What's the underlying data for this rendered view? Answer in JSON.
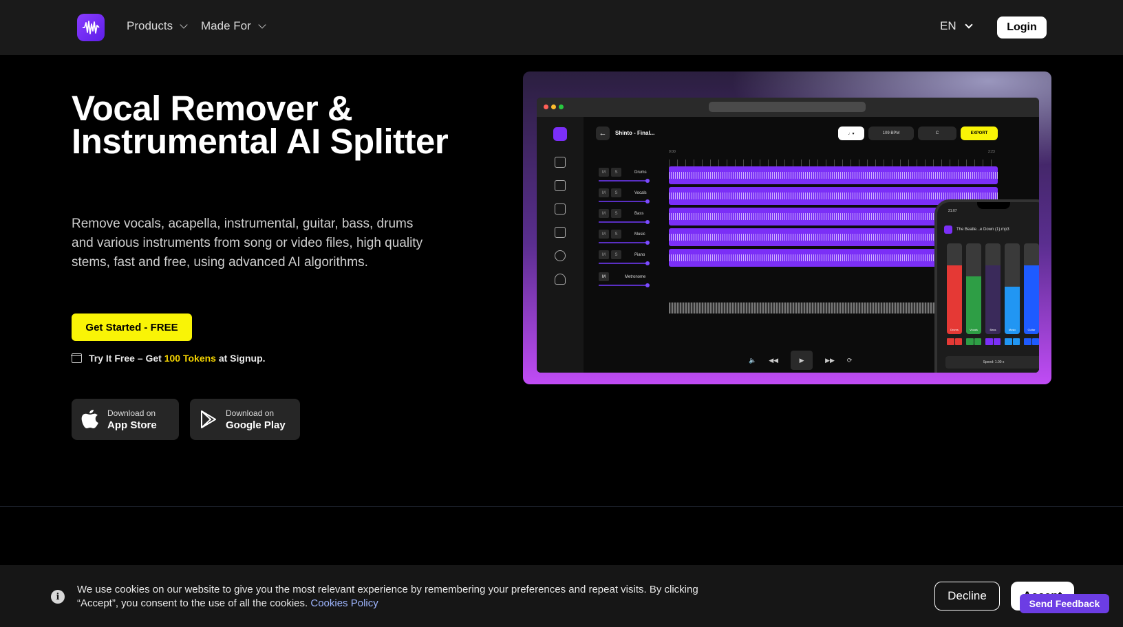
{
  "nav": {
    "products": "Products",
    "made_for": "Made For",
    "language": "EN",
    "login": "Login"
  },
  "hero": {
    "title": "Vocal Remover & Instrumental AI Splitter",
    "subtitle": "Remove vocals, acapella, instrumental, guitar, bass, drums and various instruments from song or video files, high quality stems, fast and free, using advanced AI algorithms.",
    "cta": "Get Started - FREE",
    "tokens_prefix": "Try It Free – Get",
    "tokens_highlight": "100 Tokens",
    "tokens_suffix": "at Signup."
  },
  "stores": {
    "apple": {
      "line1": "Download on",
      "line2": "App Store"
    },
    "google": {
      "line1": "Download on",
      "line2": "Google Play"
    }
  },
  "app_preview": {
    "song_title": "Shinto - Final...",
    "tempo": "109 BPM",
    "key": "C",
    "export": "EXPORT",
    "time_start": "0:00",
    "time_end": "2:23",
    "tracks": [
      "Drums",
      "Vocals",
      "Bass",
      "Music",
      "Piano",
      "Metronome"
    ],
    "mute": "M",
    "solo": "S",
    "phone": {
      "time": "21:07",
      "file": "The Beatle...e Down (1).mp3",
      "stems": [
        "Drums",
        "Vocals",
        "Bass",
        "Music",
        "Guitar"
      ],
      "speed": "Speed: 1.00 x"
    }
  },
  "cookie": {
    "text": "We use cookies on our website to give you the most relevant experience by remembering your preferences and repeat visits. By clicking “Accept”, you consent to the use of all the cookies.",
    "link": "Cookies Policy",
    "decline": "Decline",
    "accept": "Accept",
    "feedback": "Send Feedback"
  },
  "colors": {
    "accent_yellow": "#f9f406",
    "brand_purple": "#7b2ff7",
    "nav_bg": "#1a1a1a"
  }
}
